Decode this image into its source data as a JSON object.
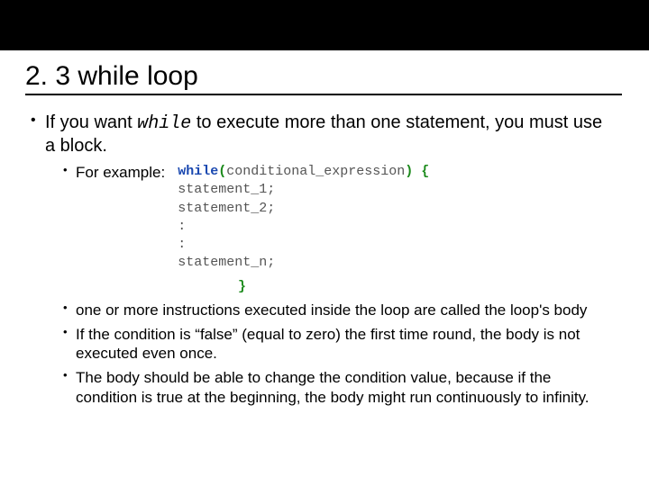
{
  "slide": {
    "title": "2. 3 while loop",
    "main_bullet_prefix": "If you want ",
    "main_bullet_kw": "while",
    "main_bullet_suffix": " to execute more than one statement, you must use a block.",
    "sub": {
      "example_label": "For example:",
      "code": {
        "line1_kw": "while",
        "line1_paren_open": "(",
        "line1_cond": "conditional_expression",
        "line1_paren_close": ")",
        "line1_brace_open": " {",
        "line2": "statement_1;",
        "line3": "statement_2;",
        "line4": ":",
        "line5": ":",
        "line6": "statement_n;",
        "brace_close": "}"
      },
      "body_bullet": "one or more instructions executed inside the loop are called the loop's body",
      "false_bullet": "If the condition is “false” (equal to zero) the first time round, the body is not executed even once.",
      "infinity_bullet": "The body should be able to change the condition value, because if the condition is true at the beginning, the body might run continuously to infinity."
    }
  }
}
